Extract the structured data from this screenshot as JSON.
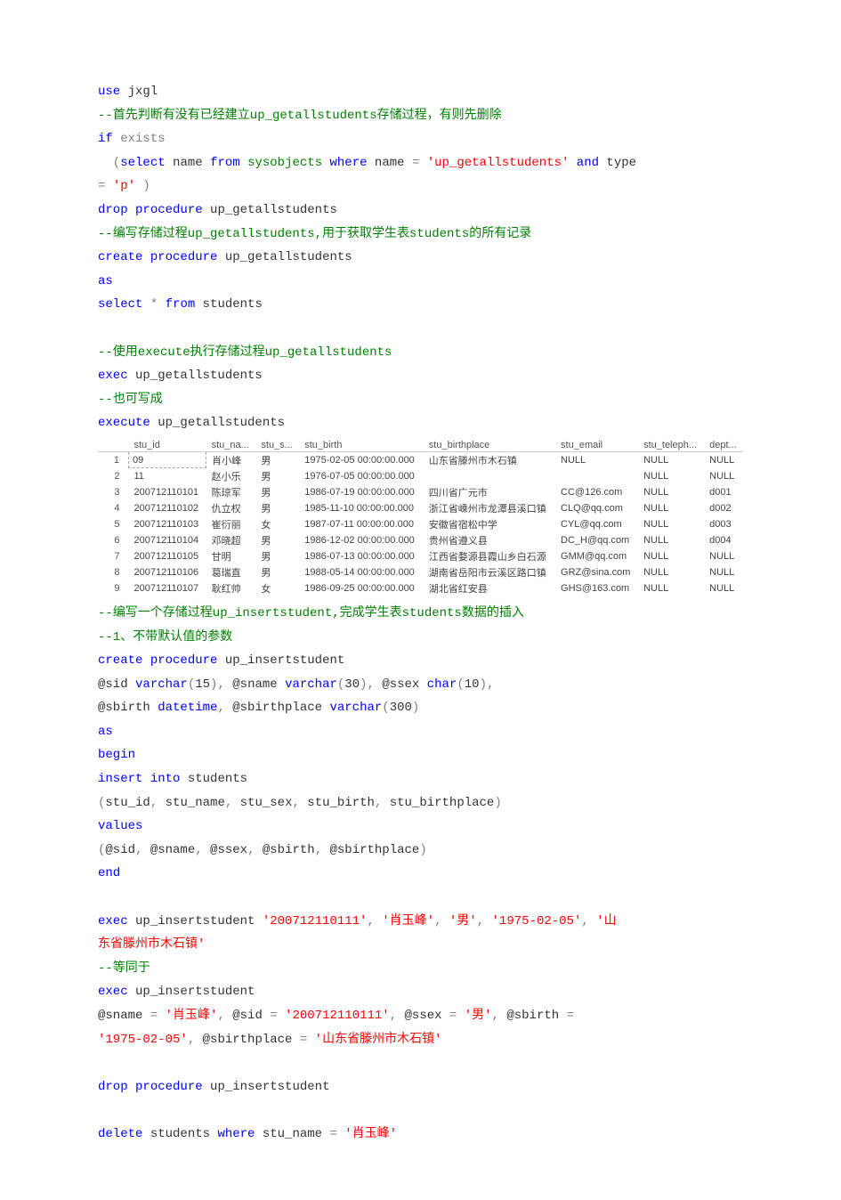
{
  "code_before_table": [
    [
      {
        "t": "use",
        "c": "kw"
      },
      {
        "t": " jxgl",
        "c": "plain"
      }
    ],
    [
      {
        "t": "--首先判断有没有已经建立up_getallstudents存储过程，有则先删除",
        "c": "cm"
      }
    ],
    [
      {
        "t": "if",
        "c": "kw"
      },
      {
        "t": " ",
        "c": "plain"
      },
      {
        "t": "exists",
        "c": "fn"
      }
    ],
    [
      {
        "t": "  (",
        "c": "fn"
      },
      {
        "t": "select",
        "c": "kw"
      },
      {
        "t": " name ",
        "c": "plain"
      },
      {
        "t": "from",
        "c": "kw"
      },
      {
        "t": " ",
        "c": "plain"
      },
      {
        "t": "sysobjects",
        "c": "cm"
      },
      {
        "t": " ",
        "c": "plain"
      },
      {
        "t": "where",
        "c": "kw"
      },
      {
        "t": " name ",
        "c": "plain"
      },
      {
        "t": "=",
        "c": "fn"
      },
      {
        "t": " ",
        "c": "plain"
      },
      {
        "t": "'up_getallstudents'",
        "c": "str"
      },
      {
        "t": " ",
        "c": "plain"
      },
      {
        "t": "and",
        "c": "kw"
      },
      {
        "t": " type ",
        "c": "plain"
      }
    ],
    [
      {
        "t": "=",
        "c": "fn"
      },
      {
        "t": " ",
        "c": "plain"
      },
      {
        "t": "'p'",
        "c": "str"
      },
      {
        "t": " )",
        "c": "fn"
      }
    ],
    [
      {
        "t": "drop",
        "c": "kw"
      },
      {
        "t": " ",
        "c": "plain"
      },
      {
        "t": "procedure",
        "c": "kw"
      },
      {
        "t": " up_getallstudents",
        "c": "plain"
      }
    ],
    [
      {
        "t": "--编写存储过程up_getallstudents,用于获取学生表students的所有记录",
        "c": "cm"
      }
    ],
    [
      {
        "t": "create",
        "c": "kw"
      },
      {
        "t": " ",
        "c": "plain"
      },
      {
        "t": "procedure",
        "c": "kw"
      },
      {
        "t": " up_getallstudents",
        "c": "plain"
      }
    ],
    [
      {
        "t": "as",
        "c": "kw"
      }
    ],
    [
      {
        "t": "select",
        "c": "kw"
      },
      {
        "t": " ",
        "c": "plain"
      },
      {
        "t": "*",
        "c": "fn"
      },
      {
        "t": " ",
        "c": "plain"
      },
      {
        "t": "from",
        "c": "kw"
      },
      {
        "t": " students",
        "c": "plain"
      }
    ],
    [
      {
        "t": " ",
        "c": "plain"
      }
    ],
    [
      {
        "t": "--使用execute执行存储过程up_getallstudents",
        "c": "cm"
      }
    ],
    [
      {
        "t": "exec",
        "c": "kw"
      },
      {
        "t": " up_getallstudents",
        "c": "plain"
      }
    ],
    [
      {
        "t": "--也可写成",
        "c": "cm"
      }
    ],
    [
      {
        "t": "execute",
        "c": "kw"
      },
      {
        "t": " up_getallstudents",
        "c": "plain"
      }
    ]
  ],
  "table": {
    "headers": [
      "",
      "stu_id",
      "stu_na...",
      "stu_s...",
      "stu_birth",
      "stu_birthplace",
      "stu_email",
      "stu_teleph...",
      "dept..."
    ],
    "rows": [
      [
        "1",
        "09",
        "肖小峰",
        "男",
        "1975-02-05 00:00:00.000",
        "山东省滕州市木石镇",
        "NULL",
        "NULL",
        "NULL"
      ],
      [
        "2",
        "11",
        "赵小乐",
        "男",
        "1976-07-05 00:00:00.000",
        "",
        "",
        "NULL",
        "NULL"
      ],
      [
        "3",
        "200712110101",
        "陈琼军",
        "男",
        "1986-07-19 00:00:00.000",
        "四川省广元市",
        "CC@126.com",
        "NULL",
        "d001"
      ],
      [
        "4",
        "200712110102",
        "仇立权",
        "男",
        "1985-11-10 00:00:00.000",
        "浙江省嵊州市龙潭县溪口镇",
        "CLQ@qq.com",
        "NULL",
        "d002"
      ],
      [
        "5",
        "200712110103",
        "崔衍丽",
        "女",
        "1987-07-11 00:00:00.000",
        "安徽省宿松中学",
        "CYL@qq.com",
        "NULL",
        "d003"
      ],
      [
        "6",
        "200712110104",
        "邓晓超",
        "男",
        "1986-12-02 00:00:00.000",
        "贵州省遵义县",
        "DC_H@qq.com",
        "NULL",
        "d004"
      ],
      [
        "7",
        "200712110105",
        "甘明",
        "男",
        "1986-07-13 00:00:00.000",
        "江西省婺源县霞山乡白石源",
        "GMM@qq.com",
        "NULL",
        "NULL"
      ],
      [
        "8",
        "200712110106",
        "葛瑞直",
        "男",
        "1988-05-14 00:00:00.000",
        "湖南省岳阳市云溪区路口镇",
        "GRZ@sina.com",
        "NULL",
        "NULL"
      ],
      [
        "9",
        "200712110107",
        "耿红帅",
        "女",
        "1986-09-25 00:00:00.000",
        "湖北省红安县",
        "GHS@163.com",
        "NULL",
        "NULL"
      ]
    ]
  },
  "code_after_table": [
    [
      {
        "t": "--编写一个存储过程up_insertstudent,完成学生表students数据的插入",
        "c": "cm"
      }
    ],
    [
      {
        "t": "--1、不带默认值的参数",
        "c": "cm"
      }
    ],
    [
      {
        "t": "create",
        "c": "kw"
      },
      {
        "t": " ",
        "c": "plain"
      },
      {
        "t": "procedure",
        "c": "kw"
      },
      {
        "t": " up_insertstudent",
        "c": "plain"
      }
    ],
    [
      {
        "t": "@sid ",
        "c": "plain"
      },
      {
        "t": "varchar",
        "c": "kw"
      },
      {
        "t": "(",
        "c": "fn"
      },
      {
        "t": "15",
        "c": "plain"
      },
      {
        "t": "),",
        "c": "fn"
      },
      {
        "t": " @sname ",
        "c": "plain"
      },
      {
        "t": "varchar",
        "c": "kw"
      },
      {
        "t": "(",
        "c": "fn"
      },
      {
        "t": "30",
        "c": "plain"
      },
      {
        "t": "),",
        "c": "fn"
      },
      {
        "t": " @ssex ",
        "c": "plain"
      },
      {
        "t": "char",
        "c": "kw"
      },
      {
        "t": "(",
        "c": "fn"
      },
      {
        "t": "10",
        "c": "plain"
      },
      {
        "t": "),",
        "c": "fn"
      }
    ],
    [
      {
        "t": "@sbirth ",
        "c": "plain"
      },
      {
        "t": "datetime",
        "c": "kw"
      },
      {
        "t": ",",
        "c": "fn"
      },
      {
        "t": " @sbirthplace ",
        "c": "plain"
      },
      {
        "t": "varchar",
        "c": "kw"
      },
      {
        "t": "(",
        "c": "fn"
      },
      {
        "t": "300",
        "c": "plain"
      },
      {
        "t": ")",
        "c": "fn"
      }
    ],
    [
      {
        "t": "as",
        "c": "kw"
      }
    ],
    [
      {
        "t": "begin",
        "c": "kw"
      }
    ],
    [
      {
        "t": "insert",
        "c": "kw"
      },
      {
        "t": " ",
        "c": "plain"
      },
      {
        "t": "into",
        "c": "kw"
      },
      {
        "t": " students",
        "c": "plain"
      }
    ],
    [
      {
        "t": "(",
        "c": "fn"
      },
      {
        "t": "stu_id",
        "c": "plain"
      },
      {
        "t": ",",
        "c": "fn"
      },
      {
        "t": " stu_name",
        "c": "plain"
      },
      {
        "t": ",",
        "c": "fn"
      },
      {
        "t": " stu_sex",
        "c": "plain"
      },
      {
        "t": ",",
        "c": "fn"
      },
      {
        "t": " stu_birth",
        "c": "plain"
      },
      {
        "t": ",",
        "c": "fn"
      },
      {
        "t": " stu_birthplace",
        "c": "plain"
      },
      {
        "t": ")",
        "c": "fn"
      }
    ],
    [
      {
        "t": "values",
        "c": "kw"
      }
    ],
    [
      {
        "t": "(",
        "c": "fn"
      },
      {
        "t": "@sid",
        "c": "plain"
      },
      {
        "t": ",",
        "c": "fn"
      },
      {
        "t": " @sname",
        "c": "plain"
      },
      {
        "t": ",",
        "c": "fn"
      },
      {
        "t": " @ssex",
        "c": "plain"
      },
      {
        "t": ",",
        "c": "fn"
      },
      {
        "t": " @sbirth",
        "c": "plain"
      },
      {
        "t": ",",
        "c": "fn"
      },
      {
        "t": " @sbirthplace",
        "c": "plain"
      },
      {
        "t": ")",
        "c": "fn"
      }
    ],
    [
      {
        "t": "end",
        "c": "kw"
      }
    ],
    [
      {
        "t": " ",
        "c": "plain"
      }
    ],
    [
      {
        "t": "exec",
        "c": "kw"
      },
      {
        "t": " up_insertstudent ",
        "c": "plain"
      },
      {
        "t": "'200712110111'",
        "c": "str"
      },
      {
        "t": ",",
        "c": "fn"
      },
      {
        "t": " ",
        "c": "plain"
      },
      {
        "t": "'肖玉峰'",
        "c": "str"
      },
      {
        "t": ",",
        "c": "fn"
      },
      {
        "t": " ",
        "c": "plain"
      },
      {
        "t": "'男'",
        "c": "str"
      },
      {
        "t": ",",
        "c": "fn"
      },
      {
        "t": " ",
        "c": "plain"
      },
      {
        "t": "'1975-02-05'",
        "c": "str"
      },
      {
        "t": ",",
        "c": "fn"
      },
      {
        "t": " ",
        "c": "plain"
      },
      {
        "t": "'山",
        "c": "str"
      }
    ],
    [
      {
        "t": "东省滕州市木石镇'",
        "c": "str"
      }
    ],
    [
      {
        "t": "--等同于",
        "c": "cm"
      }
    ],
    [
      {
        "t": "exec",
        "c": "kw"
      },
      {
        "t": " up_insertstudent",
        "c": "plain"
      }
    ],
    [
      {
        "t": "@sname ",
        "c": "plain"
      },
      {
        "t": "=",
        "c": "fn"
      },
      {
        "t": " ",
        "c": "plain"
      },
      {
        "t": "'肖玉峰'",
        "c": "str"
      },
      {
        "t": ",",
        "c": "fn"
      },
      {
        "t": " @sid ",
        "c": "plain"
      },
      {
        "t": "=",
        "c": "fn"
      },
      {
        "t": " ",
        "c": "plain"
      },
      {
        "t": "'200712110111'",
        "c": "str"
      },
      {
        "t": ",",
        "c": "fn"
      },
      {
        "t": " @ssex ",
        "c": "plain"
      },
      {
        "t": "=",
        "c": "fn"
      },
      {
        "t": " ",
        "c": "plain"
      },
      {
        "t": "'男'",
        "c": "str"
      },
      {
        "t": ",",
        "c": "fn"
      },
      {
        "t": " @sbirth ",
        "c": "plain"
      },
      {
        "t": "=",
        "c": "fn"
      },
      {
        "t": " ",
        "c": "plain"
      }
    ],
    [
      {
        "t": "'1975-02-05'",
        "c": "str"
      },
      {
        "t": ",",
        "c": "fn"
      },
      {
        "t": " @sbirthplace ",
        "c": "plain"
      },
      {
        "t": "=",
        "c": "fn"
      },
      {
        "t": " ",
        "c": "plain"
      },
      {
        "t": "'山东省滕州市木石镇'",
        "c": "str"
      }
    ],
    [
      {
        "t": " ",
        "c": "plain"
      }
    ],
    [
      {
        "t": "drop",
        "c": "kw"
      },
      {
        "t": " ",
        "c": "plain"
      },
      {
        "t": "procedure",
        "c": "kw"
      },
      {
        "t": " up_insertstudent",
        "c": "plain"
      }
    ],
    [
      {
        "t": " ",
        "c": "plain"
      }
    ],
    [
      {
        "t": "delete",
        "c": "kw"
      },
      {
        "t": " students ",
        "c": "plain"
      },
      {
        "t": "where",
        "c": "kw"
      },
      {
        "t": " stu_name ",
        "c": "plain"
      },
      {
        "t": "=",
        "c": "fn"
      },
      {
        "t": " ",
        "c": "plain"
      },
      {
        "t": "'肖玉峰'",
        "c": "str"
      }
    ]
  ]
}
